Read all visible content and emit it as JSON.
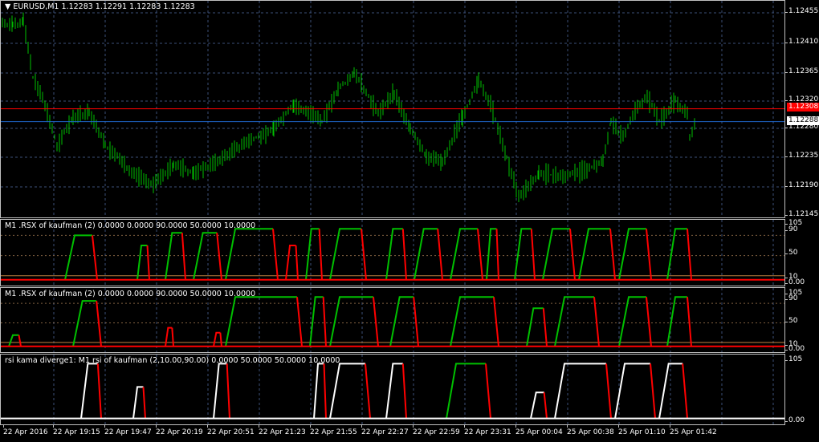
{
  "main": {
    "symbol": "EURUSD,M1",
    "ohlc": "1.12283 1.12291 1.12283 1.12283",
    "title_arrow": "▼",
    "price_ticks": [
      "1.12455",
      "1.12410",
      "1.12365",
      "1.12320",
      "1.12280",
      "1.12235",
      "1.12190",
      "1.12145"
    ],
    "red_line_label": "1.12308",
    "blue_line_label": "1.12288",
    "red_line_value": 1.12308,
    "blue_line_value": 1.12288,
    "price_range": [
      1.12145,
      1.1247
    ],
    "colors": {
      "candles": "#00c000",
      "red_line": "#ff0000",
      "blue_line": "#1e64c8",
      "grid": "#3c5078"
    }
  },
  "panes": [
    {
      "title": "M1 .RSX of kaufman (2) 0.0000 0.0000 90.0000 50.0000 10.0000",
      "ticks": [
        "105",
        "90",
        "50",
        "10",
        "0.00"
      ],
      "levels": [
        90,
        50,
        10
      ]
    },
    {
      "title": "M1 .RSX of kaufman (2) 0.0000 0.0000 90.0000 50.0000 10.0000",
      "ticks": [
        "105",
        "90",
        "50",
        "10",
        "0.00"
      ],
      "levels": [
        90,
        50,
        10
      ]
    },
    {
      "title": "rsi kama diverge1: M1  rsi of kaufman (2,10.00,90.00) 0.0000 50.0000 50.0000 10.0000",
      "ticks": [
        "105",
        "0.00"
      ],
      "levels": []
    }
  ],
  "time_axis": [
    "22 Apr 2016",
    "22 Apr 19:15",
    "22 Apr 19:47",
    "22 Apr 20:19",
    "22 Apr 20:51",
    "22 Apr 21:23",
    "22 Apr 21:55",
    "22 Apr 22:27",
    "22 Apr 22:59",
    "22 Apr 23:31",
    "25 Apr 00:04",
    "25 Apr 00:38",
    "25 Apr 01:10",
    "25 Apr 01:42"
  ]
}
